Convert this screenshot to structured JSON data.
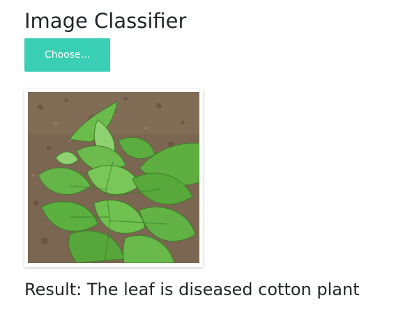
{
  "page": {
    "title": "Image Classifier"
  },
  "upload": {
    "button_label": "Choose..."
  },
  "result": {
    "text": "Result: The leaf is diseased cotton plant"
  },
  "colors": {
    "accent": "#39cfb4",
    "text": "#212529",
    "soil": "#7b6651",
    "leaf": "#5cad3f",
    "leaf_light": "#8fd070",
    "leaf_dark": "#3d7d28"
  },
  "image": {
    "subject_icon": "cotton-plant-photo"
  }
}
